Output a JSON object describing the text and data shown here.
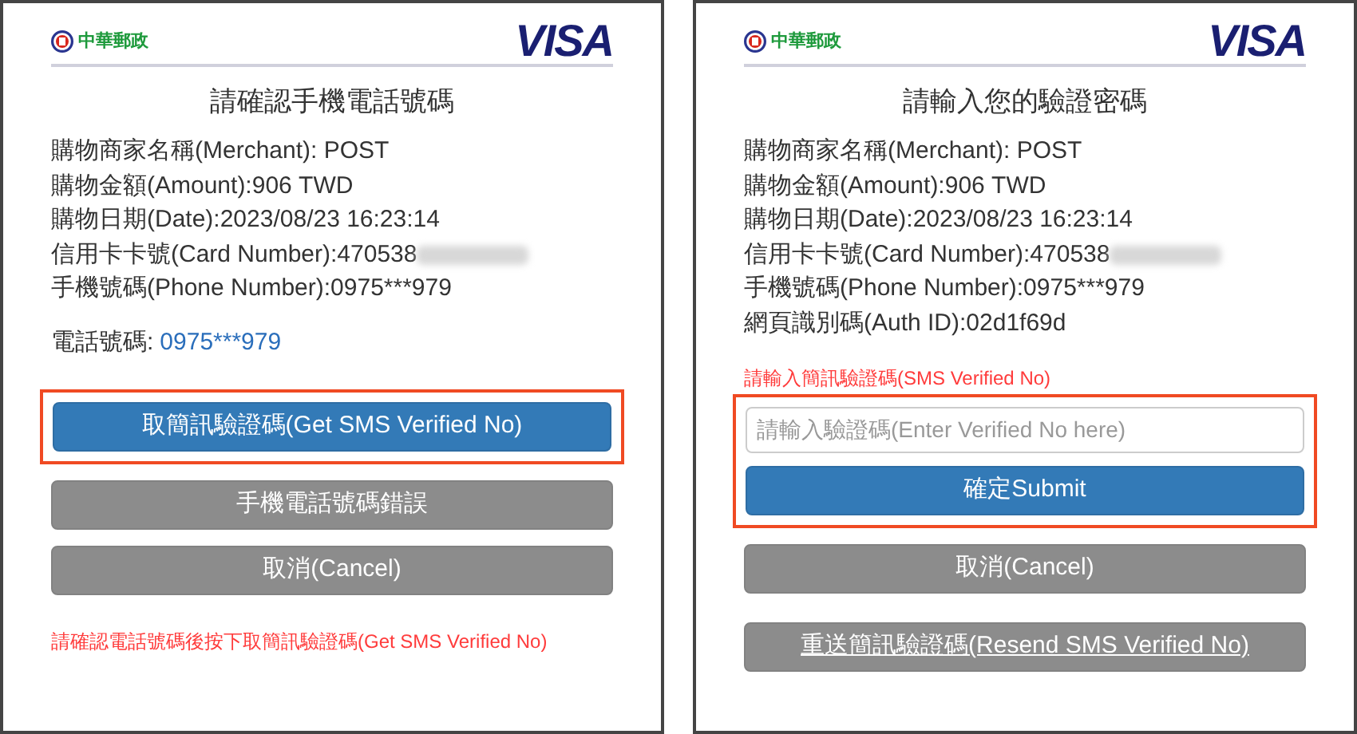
{
  "panels": [
    {
      "logo": "中華郵政",
      "brand": "VISA",
      "title": "請確認手機電話號碼",
      "blocks": [
        {
          "kind": "info",
          "lines": [
            {
              "text": "購物商家名稱(Merchant): POST",
              "redacted": false
            },
            {
              "text": "購物金額(Amount):906 TWD",
              "redacted": false
            },
            {
              "text": "購物日期(Date):2023/08/23 16:23:14",
              "redacted": false
            },
            {
              "text": "信用卡卡號(Card Number):470538",
              "redacted": true
            },
            {
              "text": "手機號碼(Phone Number):0975***979",
              "redacted": false
            }
          ]
        },
        {
          "kind": "phone",
          "label": "電話號碼:",
          "value": "0975***979"
        },
        {
          "kind": "highlight",
          "children": [
            {
              "kind": "primary_button",
              "label": "取簡訊驗證碼(Get SMS Verified No)",
              "underlined": false
            }
          ]
        },
        {
          "kind": "secondary_button",
          "label": "手機電話號碼錯誤",
          "underlined": false
        },
        {
          "kind": "secondary_button",
          "label": "取消(Cancel)",
          "underlined": false
        },
        {
          "kind": "note",
          "text": "請確認電話號碼後按下取簡訊驗證碼(Get SMS Verified No)"
        }
      ]
    },
    {
      "logo": "中華郵政",
      "brand": "VISA",
      "title": "請輸入您的驗證密碼",
      "blocks": [
        {
          "kind": "info",
          "lines": [
            {
              "text": "購物商家名稱(Merchant): POST",
              "redacted": false
            },
            {
              "text": "購物金額(Amount):906 TWD",
              "redacted": false
            },
            {
              "text": "購物日期(Date):2023/08/23 16:23:14",
              "redacted": false
            },
            {
              "text": "信用卡卡號(Card Number):470538",
              "redacted": true
            },
            {
              "text": "手機號碼(Phone Number):0975***979",
              "redacted": false
            },
            {
              "text": "網頁識別碼(Auth ID):02d1f69d",
              "redacted": false
            }
          ]
        },
        {
          "kind": "note",
          "text": "請輸入簡訊驗證碼(SMS Verified No)"
        },
        {
          "kind": "highlight",
          "children": [
            {
              "kind": "field",
              "placeholder": "請輸入驗證碼(Enter Verified No here)"
            },
            {
              "kind": "primary_button",
              "label": "確定Submit",
              "underlined": false
            }
          ]
        },
        {
          "kind": "secondary_button",
          "label": "取消(Cancel)",
          "underlined": false
        },
        {
          "kind": "secondary_button",
          "label": "重送簡訊驗證碼(Resend SMS Verified No)",
          "underlined": true
        }
      ]
    }
  ]
}
